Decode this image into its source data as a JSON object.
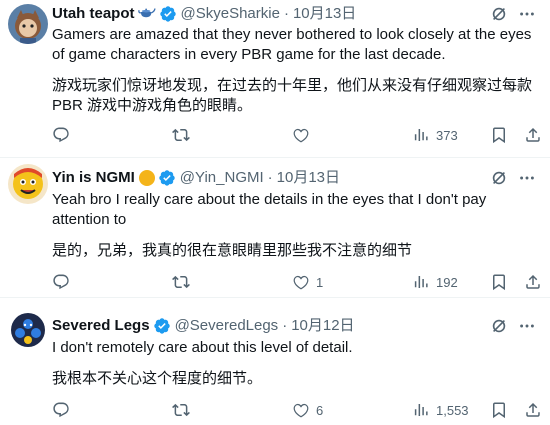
{
  "tweets": [
    {
      "name": "Utah teapot",
      "name_icon": "teapot-icon",
      "handle": "@SkyeSharkie",
      "dot": "·",
      "date": "10月13日",
      "text_en": "Gamers are amazed that they never bothered to look closely at the eyes of game characters in every PBR game for the last decade.",
      "text_zh": "游戏玩家们惊讶地发现，在过去的十年里，他们从来没有仔细观察过每款 PBR 游戏中游戏角色的眼睛。",
      "replies": "",
      "retweets": "",
      "likes": "",
      "views": "373"
    },
    {
      "name": "Yin is NGMI",
      "name_icon": "sun-emoji-icon",
      "handle": "@Yin_NGMI",
      "dot": "·",
      "date": "10月13日",
      "text_en": "Yeah bro I really care about the details in the eyes that I don't pay attention to",
      "text_zh": "是的，兄弟，我真的很在意眼睛里那些我不注意的细节",
      "replies": "",
      "retweets": "",
      "likes": "1",
      "views": "192"
    },
    {
      "name": "Severed Legs",
      "name_icon": "",
      "handle": "@SeveredLegs",
      "dot": "·",
      "date": "10月12日",
      "text_en": "I don't remotely care about this level of detail.",
      "text_zh": "我根本不关心这个程度的细节。",
      "replies": "",
      "retweets": "",
      "likes": "6",
      "views": "1,553"
    }
  ],
  "colors": {
    "text": "#0f1419",
    "secondary": "#536471",
    "verified_blue": "#1d9bf0",
    "divider": "#eff3f4"
  }
}
